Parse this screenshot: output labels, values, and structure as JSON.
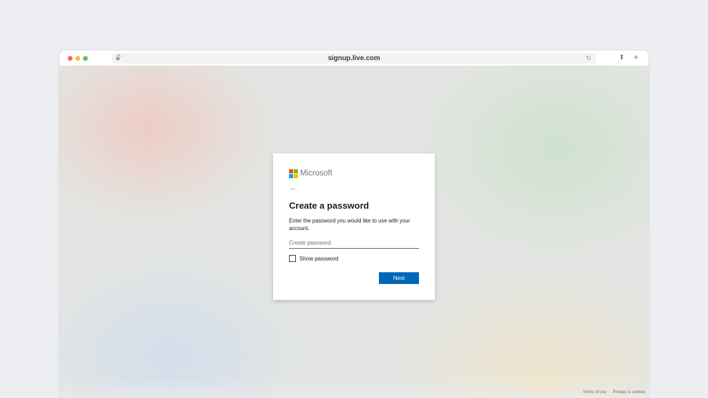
{
  "browser": {
    "url": "signup.live.com"
  },
  "card": {
    "brand": "Microsoft",
    "back_icon": "arrow-left-icon",
    "title": "Create a password",
    "description": "Enter the password you would like to use with your account.",
    "password_placeholder": "Create password",
    "password_value": "",
    "show_password_label": "Show password",
    "show_password_checked": false,
    "next_label": "Next"
  },
  "footer": {
    "terms": "Terms of use",
    "privacy": "Privacy & cookies"
  },
  "colors": {
    "primary_button": "#0067b8",
    "logo_red": "#f25022",
    "logo_green": "#7fba00",
    "logo_blue": "#00a4ef",
    "logo_yellow": "#ffb900"
  }
}
